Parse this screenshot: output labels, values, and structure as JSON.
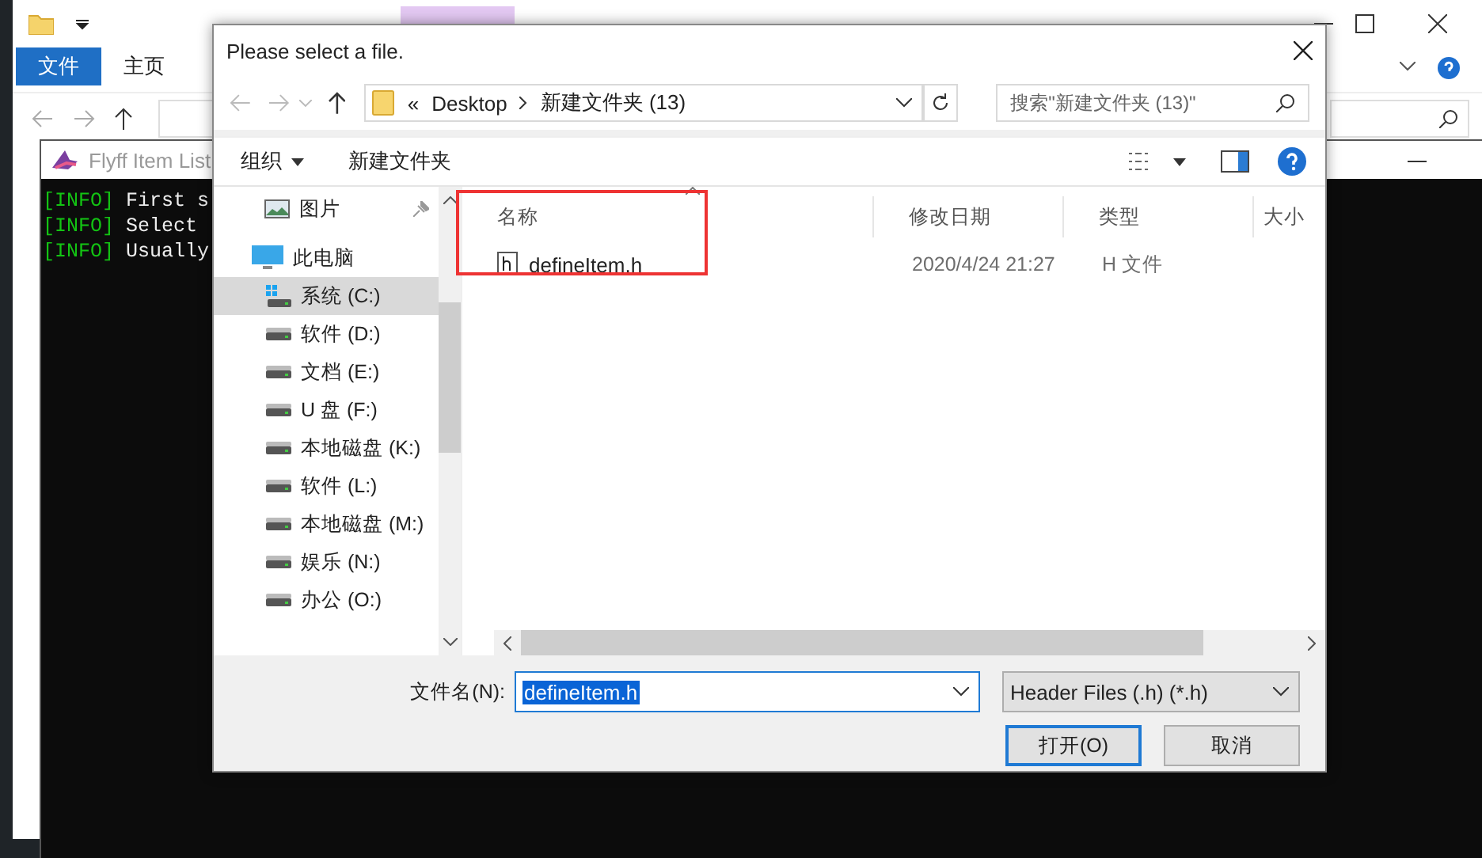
{
  "explorer_window": {
    "ribbon_tabs": [
      {
        "label": "文件",
        "selected": true
      },
      {
        "label": "主页",
        "selected": false
      }
    ]
  },
  "console_window": {
    "title": "Flyff Item List",
    "lines": [
      {
        "tag": "[INFO]",
        "text": "First s"
      },
      {
        "tag": "[INFO]",
        "text": "Select"
      },
      {
        "tag": "[INFO]",
        "text": "Usually"
      }
    ]
  },
  "dialog": {
    "title": "Please select a file.",
    "breadcrumb_prefix": "«",
    "breadcrumb": [
      "Desktop",
      "新建文件夹 (13)"
    ],
    "search": {
      "placeholder": "搜索\"新建文件夹 (13)\""
    },
    "toolbar": {
      "organize": "组织",
      "new_folder": "新建文件夹"
    },
    "nav": [
      {
        "label": "图片",
        "kind": "pictures",
        "pinned": true,
        "selected": false
      },
      {
        "label": "此电脑",
        "kind": "computer",
        "pinned": false,
        "selected": false,
        "children": [
          {
            "label": "系统 (C:)",
            "kind": "system-drive",
            "selected": true
          },
          {
            "label": "软件 (D:)",
            "kind": "drive",
            "selected": false
          },
          {
            "label": "文档 (E:)",
            "kind": "drive",
            "selected": false
          },
          {
            "label": "U 盘 (F:)",
            "kind": "drive",
            "selected": false
          },
          {
            "label": "本地磁盘 (K:)",
            "kind": "drive",
            "selected": false
          },
          {
            "label": "软件 (L:)",
            "kind": "drive",
            "selected": false
          },
          {
            "label": "本地磁盘 (M:)",
            "kind": "drive",
            "selected": false
          },
          {
            "label": "娱乐 (N:)",
            "kind": "drive",
            "selected": false
          },
          {
            "label": "办公 (O:)",
            "kind": "drive",
            "selected": false
          }
        ]
      }
    ],
    "columns": [
      "名称",
      "修改日期",
      "类型",
      "大小"
    ],
    "files": [
      {
        "name": "defineItem.h",
        "modified": "2020/4/24 21:27",
        "type": "H 文件",
        "highlighted": true
      }
    ],
    "file_name": {
      "label": "文件名(N):",
      "value": "defineItem.h"
    },
    "filter": "Header Files (.h) (*.h)",
    "buttons": [
      {
        "label": "打开(O)",
        "default": true
      },
      {
        "label": "取消",
        "default": false
      }
    ]
  }
}
